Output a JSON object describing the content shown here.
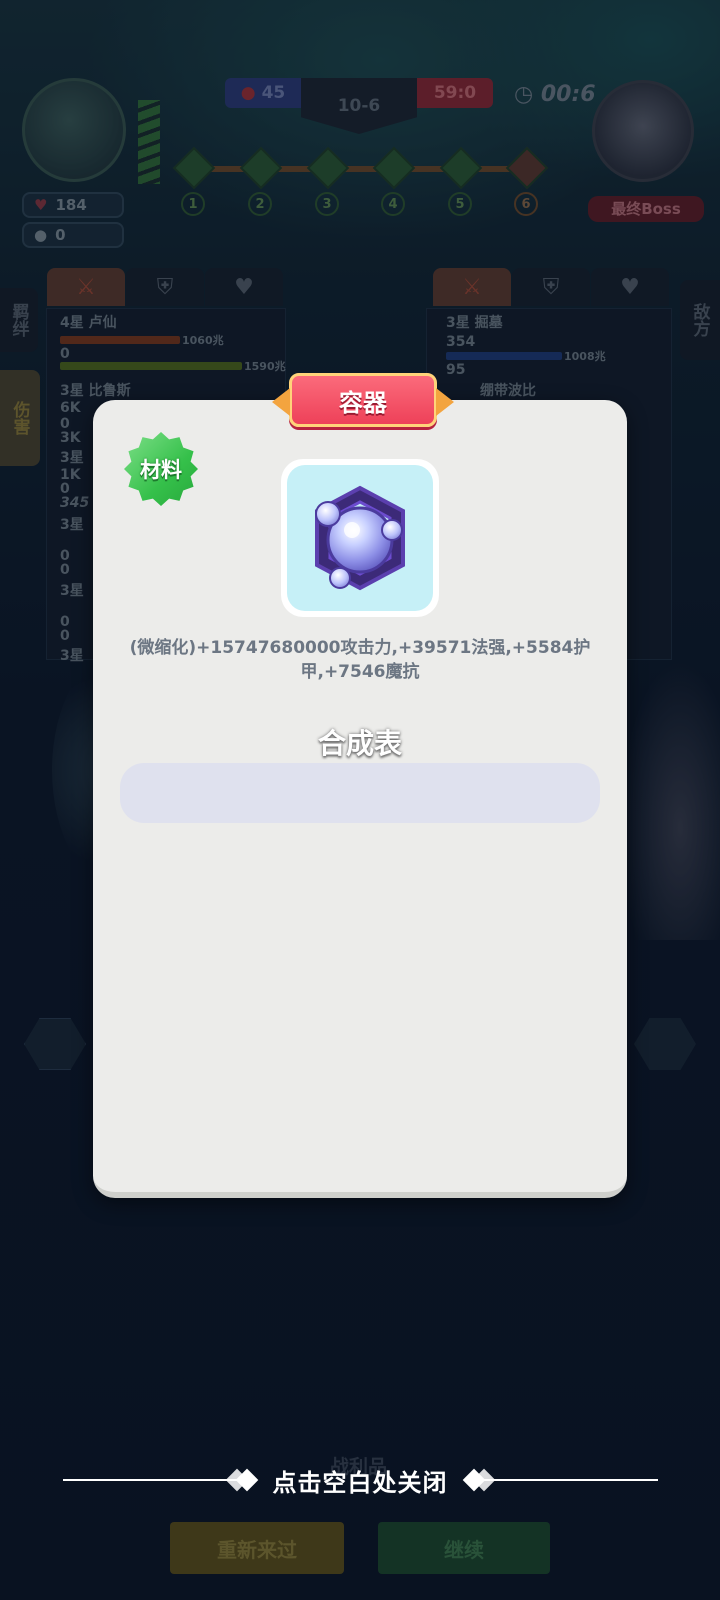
{
  "hud": {
    "player_hp": "184",
    "player_coins": "0",
    "score_blue": "45",
    "round": "10-6",
    "score_red": "59:0",
    "timer": "00:6",
    "boss_label": "最终Boss",
    "stages": [
      "1",
      "2",
      "3",
      "4",
      "5",
      "6"
    ]
  },
  "left_panel": {
    "side_tabs": [
      "羁绊",
      "伤害"
    ],
    "units": [
      {
        "name": "4星 卢仙",
        "v1": "1060兆",
        "v2": "0",
        "v3": "1590兆"
      },
      {
        "name": "3星 比鲁斯",
        "v1": "6K",
        "v2": "0",
        "v3": "3K"
      },
      {
        "name": "3星",
        "v1": "1K",
        "v2": "0",
        "v3": "345"
      },
      {
        "name": "3星",
        "v1": "0",
        "v2": "0",
        "v3": ""
      },
      {
        "name": "3星",
        "v1": "0",
        "v2": "0",
        "v3": ""
      },
      {
        "name": "3星",
        "v1": "",
        "v2": "",
        "v3": ""
      }
    ]
  },
  "right_panel": {
    "side_tab": "敌方",
    "units": [
      {
        "name": "3星 掘墓",
        "v1": "354",
        "v2": "1008兆",
        "v3": "95"
      },
      {
        "name": "绷带波比",
        "v1": "",
        "v2": "",
        "v3": ""
      }
    ]
  },
  "bottom": {
    "loot_label": "战利品",
    "retry_button": "重新来过",
    "continue_button": "继续"
  },
  "modal": {
    "title": "容器",
    "badge": "材料",
    "item_icon": "orb-container-icon",
    "description": "(微缩化)+15747680000攻击力,+39571法强,+5584护甲,+7546魔抗",
    "recipe_title": "合成表"
  },
  "close_hint": "点击空白处关闭",
  "colors": {
    "modal_bg": "#ececea",
    "title_tag": "#ee4159",
    "badge_green": "#35c04a",
    "item_bg": "#c6f0f7",
    "recipe_box": "#dfe1ee"
  }
}
